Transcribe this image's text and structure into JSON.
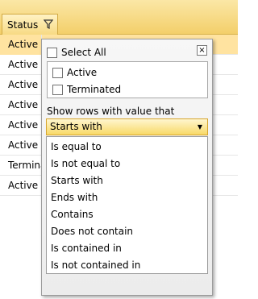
{
  "header": {
    "column_title": "Status"
  },
  "rows": [
    "Active",
    "Active",
    "Active",
    "Active",
    "Active",
    "Active",
    "Terminated",
    "Active"
  ],
  "filter_popup": {
    "select_all_label": "Select All",
    "close_symbol": "×",
    "values": [
      "Active",
      "Terminated"
    ],
    "condition_label": "Show rows with value that",
    "selected_condition": "Starts with",
    "dropdown_arrow": "▼",
    "options": [
      "Is equal to",
      "Is not equal to",
      "Starts with",
      "Ends with",
      "Contains",
      "Does not contain",
      "Is contained in",
      "Is not contained in"
    ]
  },
  "colors": {
    "header_gold": "#f3cf6a",
    "selected_row": "#ffe3a0",
    "dropdown_accent": "#f8d968"
  }
}
